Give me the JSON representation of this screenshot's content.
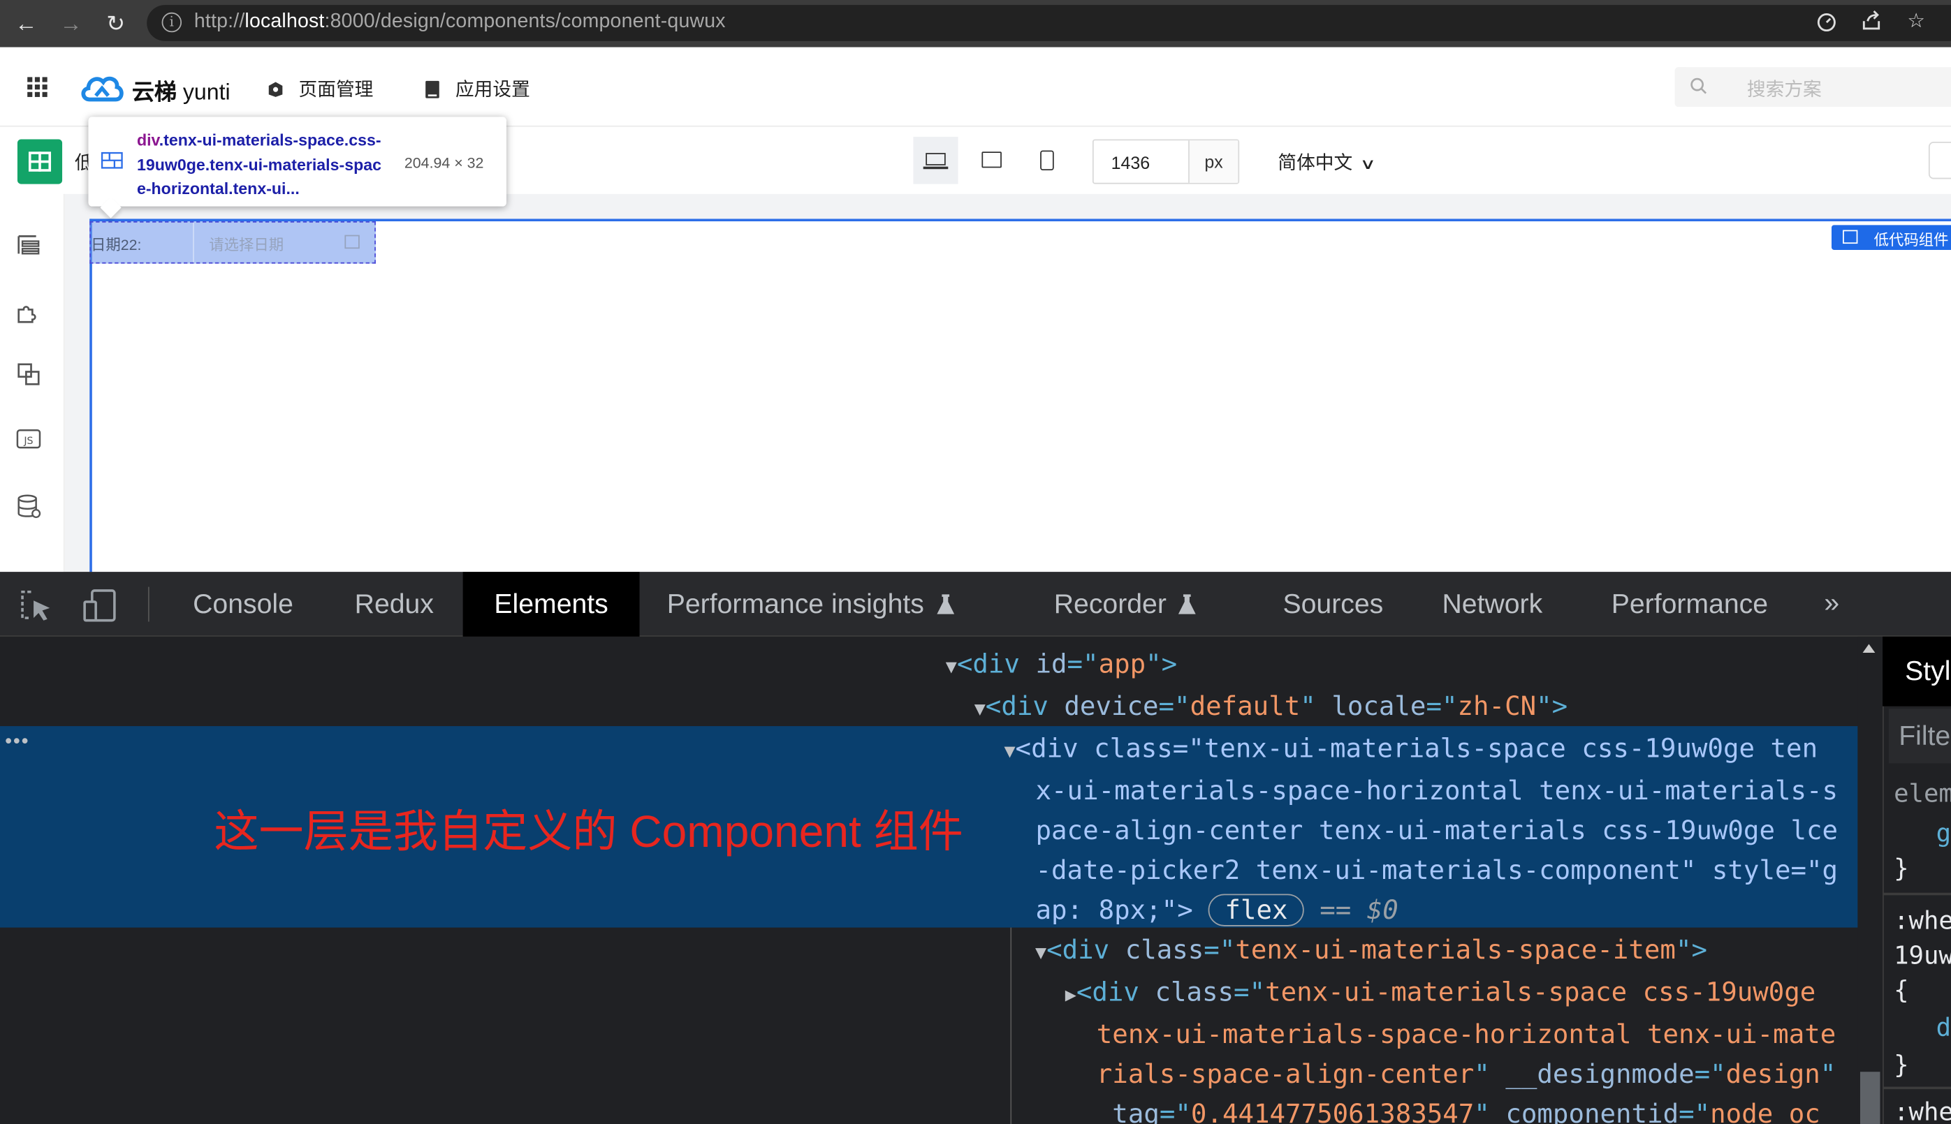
{
  "browser": {
    "url_prefix": "http://",
    "url_host": "localhost",
    "url_rest": ":8000/design/components/component-quwux"
  },
  "app": {
    "brand_cn": "云梯",
    "brand_en": "yunti",
    "menu": [
      {
        "label": "页面管理"
      },
      {
        "label": "应用设置"
      }
    ],
    "search_placeholder": "搜索方案"
  },
  "toolbar": {
    "page_name": "低",
    "width_value": "1436",
    "width_unit": "px",
    "language": "简体中文"
  },
  "tooltip": {
    "selector_tag": "div",
    "selector_rest": ".tenx-ui-materials-space.css-19uw0ge.tenx-ui-materials-space-horizontal.tenx-ui...",
    "size": "204.94 × 32"
  },
  "canvas": {
    "date_label": "日期22:",
    "date_placeholder": "请选择日期",
    "component_tag": "低代码组件"
  },
  "devtools": {
    "tabs": [
      "Console",
      "Redux",
      "Elements",
      "Performance insights",
      "Recorder",
      "Sources",
      "Network",
      "Performance"
    ],
    "active_tab": "Elements",
    "annotation": "这一层是我自定义的 Component 组件",
    "styles_header": "Styl",
    "styles_filter": "Filte",
    "styles_lines": [
      "elem",
      "g",
      "}",
      ":whe",
      "19uw",
      "{",
      "d",
      "}",
      ":whe"
    ],
    "dom_end_marker": "== $0",
    "flex_badge": "flex"
  }
}
